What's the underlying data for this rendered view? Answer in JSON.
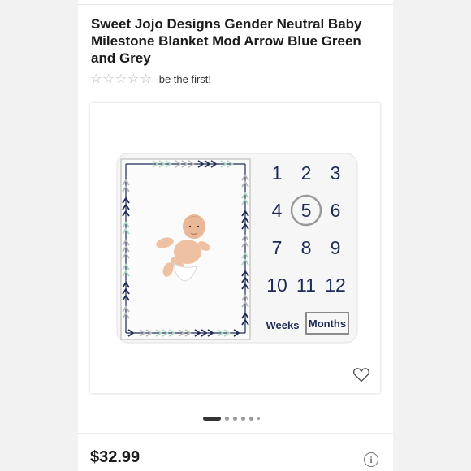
{
  "product": {
    "title": "Sweet Jojo Designs Gender Neutral Baby Milestone Blanket Mod Arrow Blue Green and Grey",
    "rating_text": "be the first!",
    "price": "$32.99"
  },
  "blanket": {
    "numbers": [
      "1",
      "2",
      "3",
      "4",
      "5",
      "6",
      "7",
      "8",
      "9",
      "10",
      "11",
      "12"
    ],
    "highlighted_number": "5",
    "labels": [
      "Weeks",
      "Months"
    ]
  },
  "icons": {
    "stars": [
      "star-outline",
      "star-outline",
      "star-outline",
      "star-outline",
      "star-outline"
    ],
    "favorite": "heart-outline-icon",
    "info": "info-icon"
  },
  "info_glyph": "i",
  "carousel": {
    "total": 6,
    "active_index": 0
  },
  "colors": {
    "navy": "#1e2b55",
    "mint": "#a8d8bf",
    "grey": "#b8b8b8",
    "text": "#1b1b1b"
  }
}
